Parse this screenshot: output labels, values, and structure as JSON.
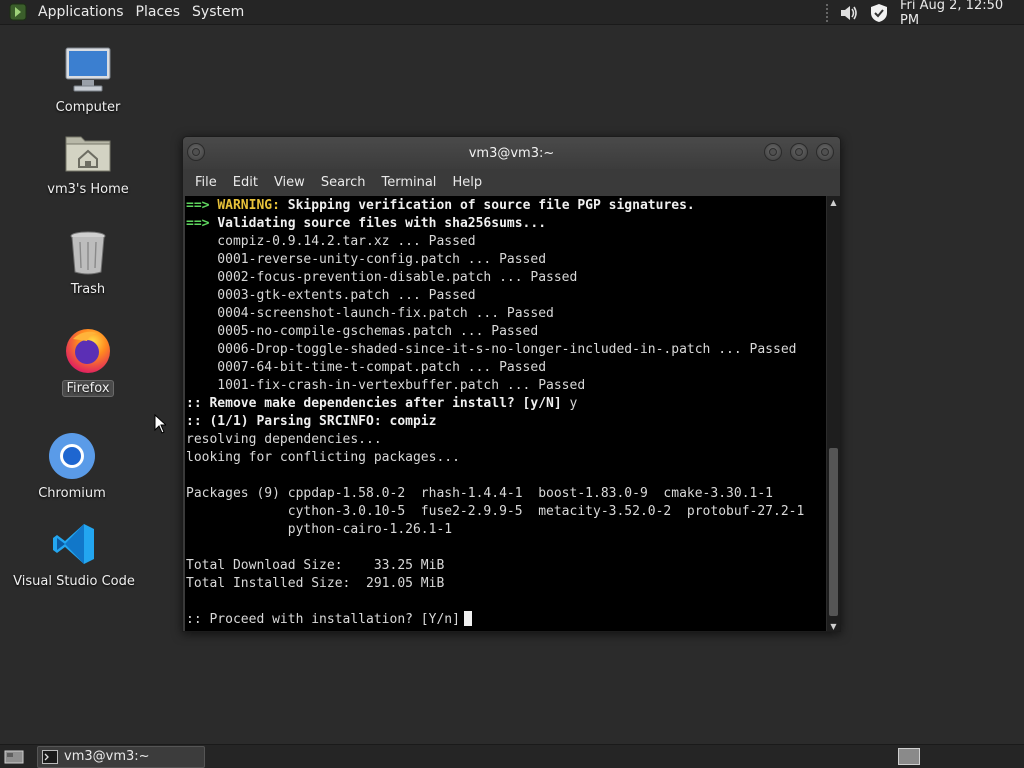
{
  "top_panel": {
    "menus": [
      "Applications",
      "Places",
      "System"
    ],
    "clock": "Fri Aug  2, 12:50 PM",
    "icons": [
      "menu-logo-icon",
      "volume-icon",
      "shield-icon"
    ]
  },
  "desktop": {
    "icons": [
      {
        "label": "Computer",
        "icon": "computer-icon"
      },
      {
        "label": "vm3's Home",
        "icon": "home-folder-icon"
      },
      {
        "label": "Trash",
        "icon": "trash-icon"
      },
      {
        "label": "Firefox",
        "icon": "firefox-icon"
      },
      {
        "label": "Chromium",
        "icon": "chromium-icon"
      },
      {
        "label": "Visual Studio Code",
        "icon": "vscode-icon"
      }
    ]
  },
  "terminal": {
    "title": "vm3@vm3:~",
    "menus": [
      "File",
      "Edit",
      "View",
      "Search",
      "Terminal",
      "Help"
    ],
    "lines": [
      {
        "prefix": "==> ",
        "prefix_style": "g",
        "label": "WARNING:",
        "label_style": "y",
        "text": " Skipping verification of source file PGP signatures.",
        "text_style": "b"
      },
      {
        "prefix": "==> ",
        "prefix_style": "g",
        "label": "",
        "label_style": "",
        "text": "Validating source files with sha256sums...",
        "text_style": "b"
      },
      {
        "prefix": "",
        "prefix_style": "",
        "label": "",
        "label_style": "",
        "text": "    compiz-0.9.14.2.tar.xz ... Passed",
        "text_style": ""
      },
      {
        "prefix": "",
        "prefix_style": "",
        "label": "",
        "label_style": "",
        "text": "    0001-reverse-unity-config.patch ... Passed",
        "text_style": ""
      },
      {
        "prefix": "",
        "prefix_style": "",
        "label": "",
        "label_style": "",
        "text": "    0002-focus-prevention-disable.patch ... Passed",
        "text_style": ""
      },
      {
        "prefix": "",
        "prefix_style": "",
        "label": "",
        "label_style": "",
        "text": "    0003-gtk-extents.patch ... Passed",
        "text_style": ""
      },
      {
        "prefix": "",
        "prefix_style": "",
        "label": "",
        "label_style": "",
        "text": "    0004-screenshot-launch-fix.patch ... Passed",
        "text_style": ""
      },
      {
        "prefix": "",
        "prefix_style": "",
        "label": "",
        "label_style": "",
        "text": "    0005-no-compile-gschemas.patch ... Passed",
        "text_style": ""
      },
      {
        "prefix": "",
        "prefix_style": "",
        "label": "",
        "label_style": "",
        "text": "    0006-Drop-toggle-shaded-since-it-s-no-longer-included-in-.patch ... Passed",
        "text_style": ""
      },
      {
        "prefix": "",
        "prefix_style": "",
        "label": "",
        "label_style": "",
        "text": "    0007-64-bit-time-t-compat.patch ... Passed",
        "text_style": ""
      },
      {
        "prefix": "",
        "prefix_style": "",
        "label": "",
        "label_style": "",
        "text": "    1001-fix-crash-in-vertexbuffer.patch ... Passed",
        "text_style": ""
      },
      {
        "prefix": "",
        "prefix_style": "",
        "label": ":: Remove make dependencies after install? [y/N]",
        "label_style": "b",
        "text": " y",
        "text_style": ""
      },
      {
        "prefix": "",
        "prefix_style": "",
        "label": ":: (1/1) Parsing SRCINFO: compiz",
        "label_style": "b",
        "text": "",
        "text_style": ""
      },
      {
        "prefix": "",
        "prefix_style": "",
        "label": "",
        "label_style": "",
        "text": "resolving dependencies...",
        "text_style": ""
      },
      {
        "prefix": "",
        "prefix_style": "",
        "label": "",
        "label_style": "",
        "text": "looking for conflicting packages...",
        "text_style": ""
      },
      {
        "prefix": "",
        "prefix_style": "",
        "label": "",
        "label_style": "",
        "text": "",
        "text_style": ""
      },
      {
        "prefix": "",
        "prefix_style": "",
        "label": "",
        "label_style": "",
        "text": "Packages (9) cppdap-1.58.0-2  rhash-1.4.4-1  boost-1.83.0-9  cmake-3.30.1-1",
        "text_style": ""
      },
      {
        "prefix": "",
        "prefix_style": "",
        "label": "",
        "label_style": "",
        "text": "             cython-3.0.10-5  fuse2-2.9.9-5  metacity-3.52.0-2  protobuf-27.2-1",
        "text_style": ""
      },
      {
        "prefix": "",
        "prefix_style": "",
        "label": "",
        "label_style": "",
        "text": "             python-cairo-1.26.1-1",
        "text_style": ""
      },
      {
        "prefix": "",
        "prefix_style": "",
        "label": "",
        "label_style": "",
        "text": "",
        "text_style": ""
      },
      {
        "prefix": "",
        "prefix_style": "",
        "label": "",
        "label_style": "",
        "text": "Total Download Size:    33.25 MiB",
        "text_style": ""
      },
      {
        "prefix": "",
        "prefix_style": "",
        "label": "",
        "label_style": "",
        "text": "Total Installed Size:  291.05 MiB",
        "text_style": ""
      },
      {
        "prefix": "",
        "prefix_style": "",
        "label": "",
        "label_style": "",
        "text": "",
        "text_style": ""
      },
      {
        "prefix": "",
        "prefix_style": "",
        "label": "",
        "label_style": "",
        "text": ":: Proceed with installation? [Y/n]",
        "text_style": "",
        "cursor": true
      }
    ]
  },
  "bottom_panel": {
    "task_label": "vm3@vm3:~"
  }
}
